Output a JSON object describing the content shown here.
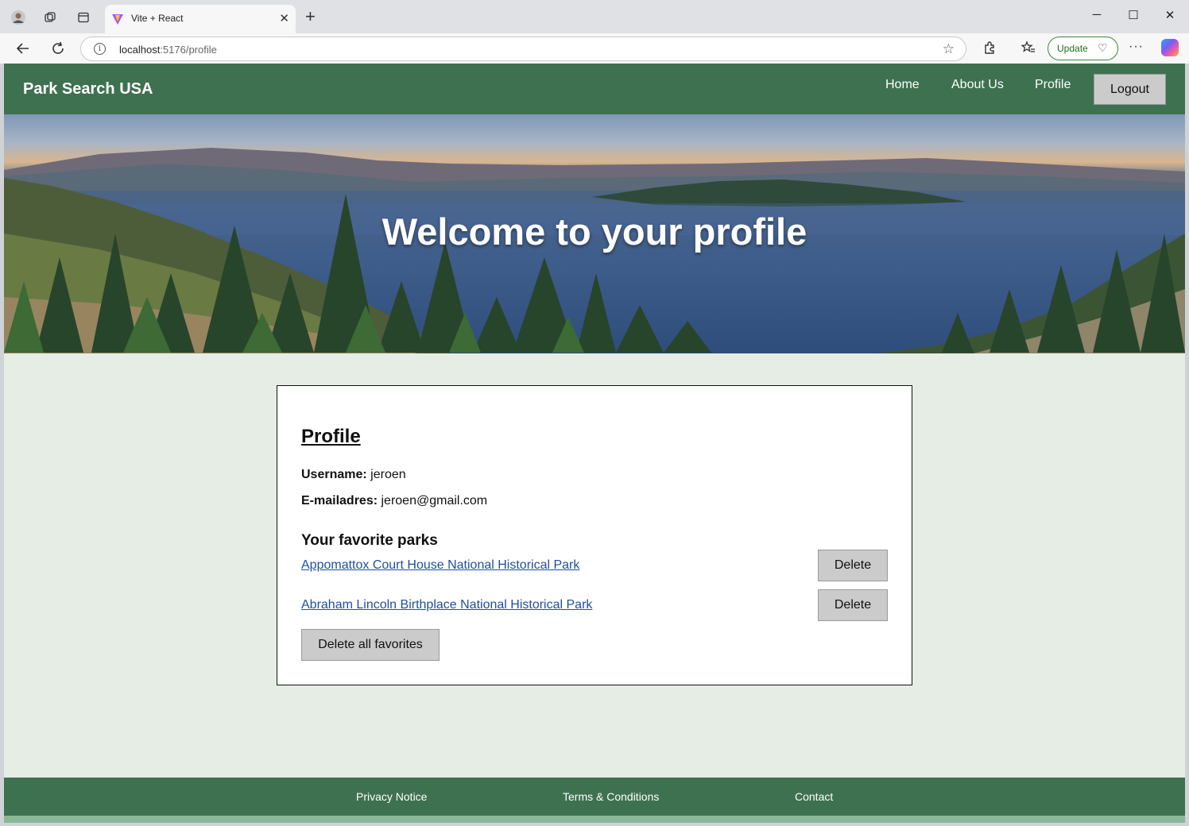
{
  "browser": {
    "tab_title": "Vite + React",
    "url_host": "localhost",
    "url_rest": ":5176/profile",
    "update_label": "Update"
  },
  "site": {
    "brand": "Park Search USA",
    "nav": [
      "Home",
      "About Us",
      "Profile"
    ],
    "logout_label": "Logout"
  },
  "hero": {
    "title": "Welcome to your profile"
  },
  "profile": {
    "heading": "Profile",
    "username_label": "Username:",
    "username": "jeroen",
    "email_label": "E-mailadres:",
    "email": "jeroen@gmail.com",
    "favorites_heading": "Your favorite parks",
    "favorites": [
      {
        "name": "Appomattox Court House National Historical Park",
        "delete_label": "Delete"
      },
      {
        "name": "Abraham Lincoln Birthplace National Historical Park",
        "delete_label": "Delete"
      }
    ],
    "delete_all_label": "Delete all favorites"
  },
  "footer": {
    "links": [
      "Privacy Notice",
      "Terms & Conditions",
      "Contact"
    ]
  },
  "colors": {
    "nav_green": "#3e7150",
    "page_bg": "#e5ede4",
    "link_blue": "#1f4fa0",
    "button_gray": "#cbcbcb"
  }
}
